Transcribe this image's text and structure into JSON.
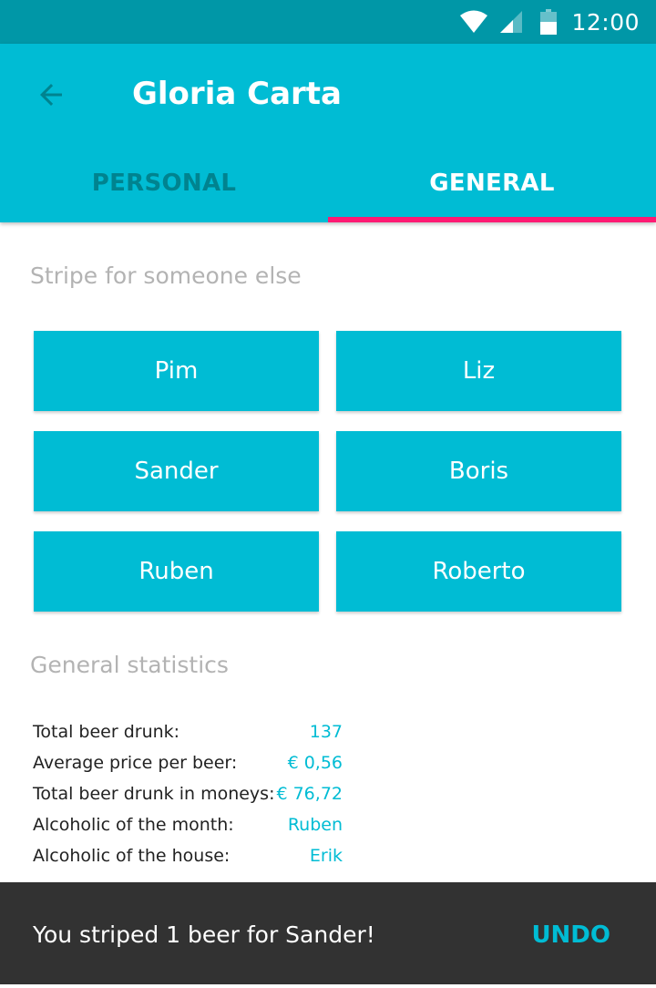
{
  "status_bar": {
    "time": "12:00",
    "icons": [
      "wifi-icon",
      "signal-icon",
      "battery-icon"
    ]
  },
  "app_bar": {
    "title": "Gloria Carta",
    "back_icon": "arrow-back-icon",
    "tabs": [
      {
        "label": "PERSONAL",
        "selected": false
      },
      {
        "label": "GENERAL",
        "selected": true
      }
    ]
  },
  "stripe_section": {
    "heading": "Stripe for someone else",
    "people": [
      "Pim",
      "Liz",
      "Sander",
      "Boris",
      "Ruben",
      "Roberto"
    ]
  },
  "stats_section": {
    "heading": "General statistics",
    "rows": [
      {
        "label": "Total beer drunk:",
        "value": "137"
      },
      {
        "label": "Average price per beer:",
        "value": "€ 0,56"
      },
      {
        "label": "Total beer drunk in moneys:",
        "value": "€ 76,72"
      },
      {
        "label": "Alcoholic of the month:",
        "value": "Ruben"
      },
      {
        "label": "Alcoholic of the house:",
        "value": "Erik"
      }
    ]
  },
  "snackbar": {
    "message": "You striped 1 beer for Sander!",
    "action": "UNDO"
  },
  "colors": {
    "primary": "#00bcd4",
    "primary_dark": "#0097a7",
    "accent": "#ff1a73",
    "snackbar_bg": "#323232"
  }
}
